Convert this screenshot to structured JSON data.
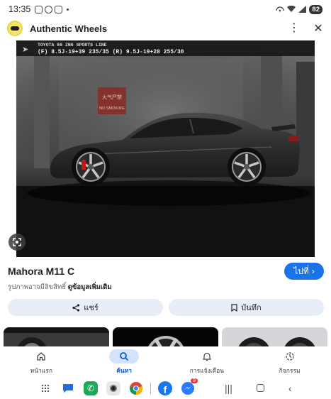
{
  "status_bar": {
    "time": "13:35",
    "battery": "82"
  },
  "header": {
    "logo_icon": "authentic-wheels-logo",
    "title": "Authentic Wheels",
    "menu_icon": "more-vert-icon",
    "close_icon": "close-icon"
  },
  "image": {
    "banner_line1": "TOYOTA 86 ZN6 SPORTS LINE",
    "banner_line2": "(F) 8.5J-19+39  235/35  (R) 9.5J-19+28  255/30",
    "sign_text": "火气严禁\nNO SMOKING"
  },
  "product": {
    "title": "Mahora M11 C",
    "visit_label": "ไปที่",
    "copyright_text": "รูปภาพอาจมีลิขสิทธิ์",
    "copyright_link": "ดูข้อมูลเพิ่มเติม"
  },
  "actions": {
    "share_label": "แชร์",
    "save_label": "บันทึก"
  },
  "bottom_nav": {
    "items": [
      {
        "label": "หน้าแรก",
        "icon": "home-icon",
        "active": false
      },
      {
        "label": "ค้นหา",
        "icon": "search-icon",
        "active": true
      },
      {
        "label": "การแจ้งเตือน",
        "icon": "bell-icon",
        "active": false
      },
      {
        "label": "กิจกรรม",
        "icon": "activity-icon",
        "active": false
      }
    ]
  },
  "dock": {
    "messenger_badge": "9"
  },
  "colors": {
    "accent": "#1a73e8",
    "active_nav_bg": "#d3e3fd",
    "action_bg": "#e8eef8"
  }
}
